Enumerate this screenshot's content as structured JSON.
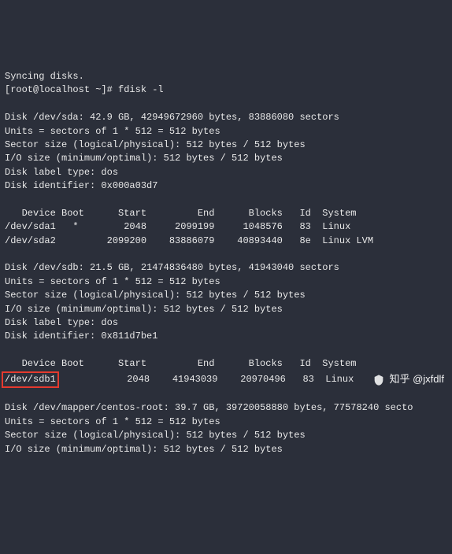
{
  "prompt_line1": "Syncing disks.",
  "prompt_line2": "[root@localhost ~]# fdisk -l",
  "sda": {
    "header": "Disk /dev/sda: 42.9 GB, 42949672960 bytes, 83886080 sectors",
    "units": "Units = sectors of 1 * 512 = 512 bytes",
    "sector": "Sector size (logical/physical): 512 bytes / 512 bytes",
    "io": "I/O size (minimum/optimal): 512 bytes / 512 bytes",
    "label": "Disk label type: dos",
    "ident": "Disk identifier: 0x000a03d7",
    "thead": "   Device Boot      Start         End      Blocks   Id  System",
    "row1": "/dev/sda1   *        2048     2099199     1048576   83  Linux",
    "row2": "/dev/sda2         2099200    83886079    40893440   8e  Linux LVM"
  },
  "sdb": {
    "header": "Disk /dev/sdb: 21.5 GB, 21474836480 bytes, 41943040 sectors",
    "units": "Units = sectors of 1 * 512 = 512 bytes",
    "sector": "Sector size (logical/physical): 512 bytes / 512 bytes",
    "io": "I/O size (minimum/optimal): 512 bytes / 512 bytes",
    "label": "Disk label type: dos",
    "ident": "Disk identifier: 0x811d7be1",
    "thead": "   Device Boot      Start         End      Blocks   Id  System",
    "row1_dev": "/dev/sdb1",
    "row1_rest": "            2048    41943039    20970496   83  Linux"
  },
  "mapper": {
    "header": "Disk /dev/mapper/centos-root: 39.7 GB, 39720058880 bytes, 77578240 secto",
    "units": "Units = sectors of 1 * 512 = 512 bytes",
    "sector": "Sector size (logical/physical): 512 bytes / 512 bytes",
    "io": "I/O size (minimum/optimal): 512 bytes / 512 bytes"
  },
  "watermark": "知乎 @jxfdlf"
}
